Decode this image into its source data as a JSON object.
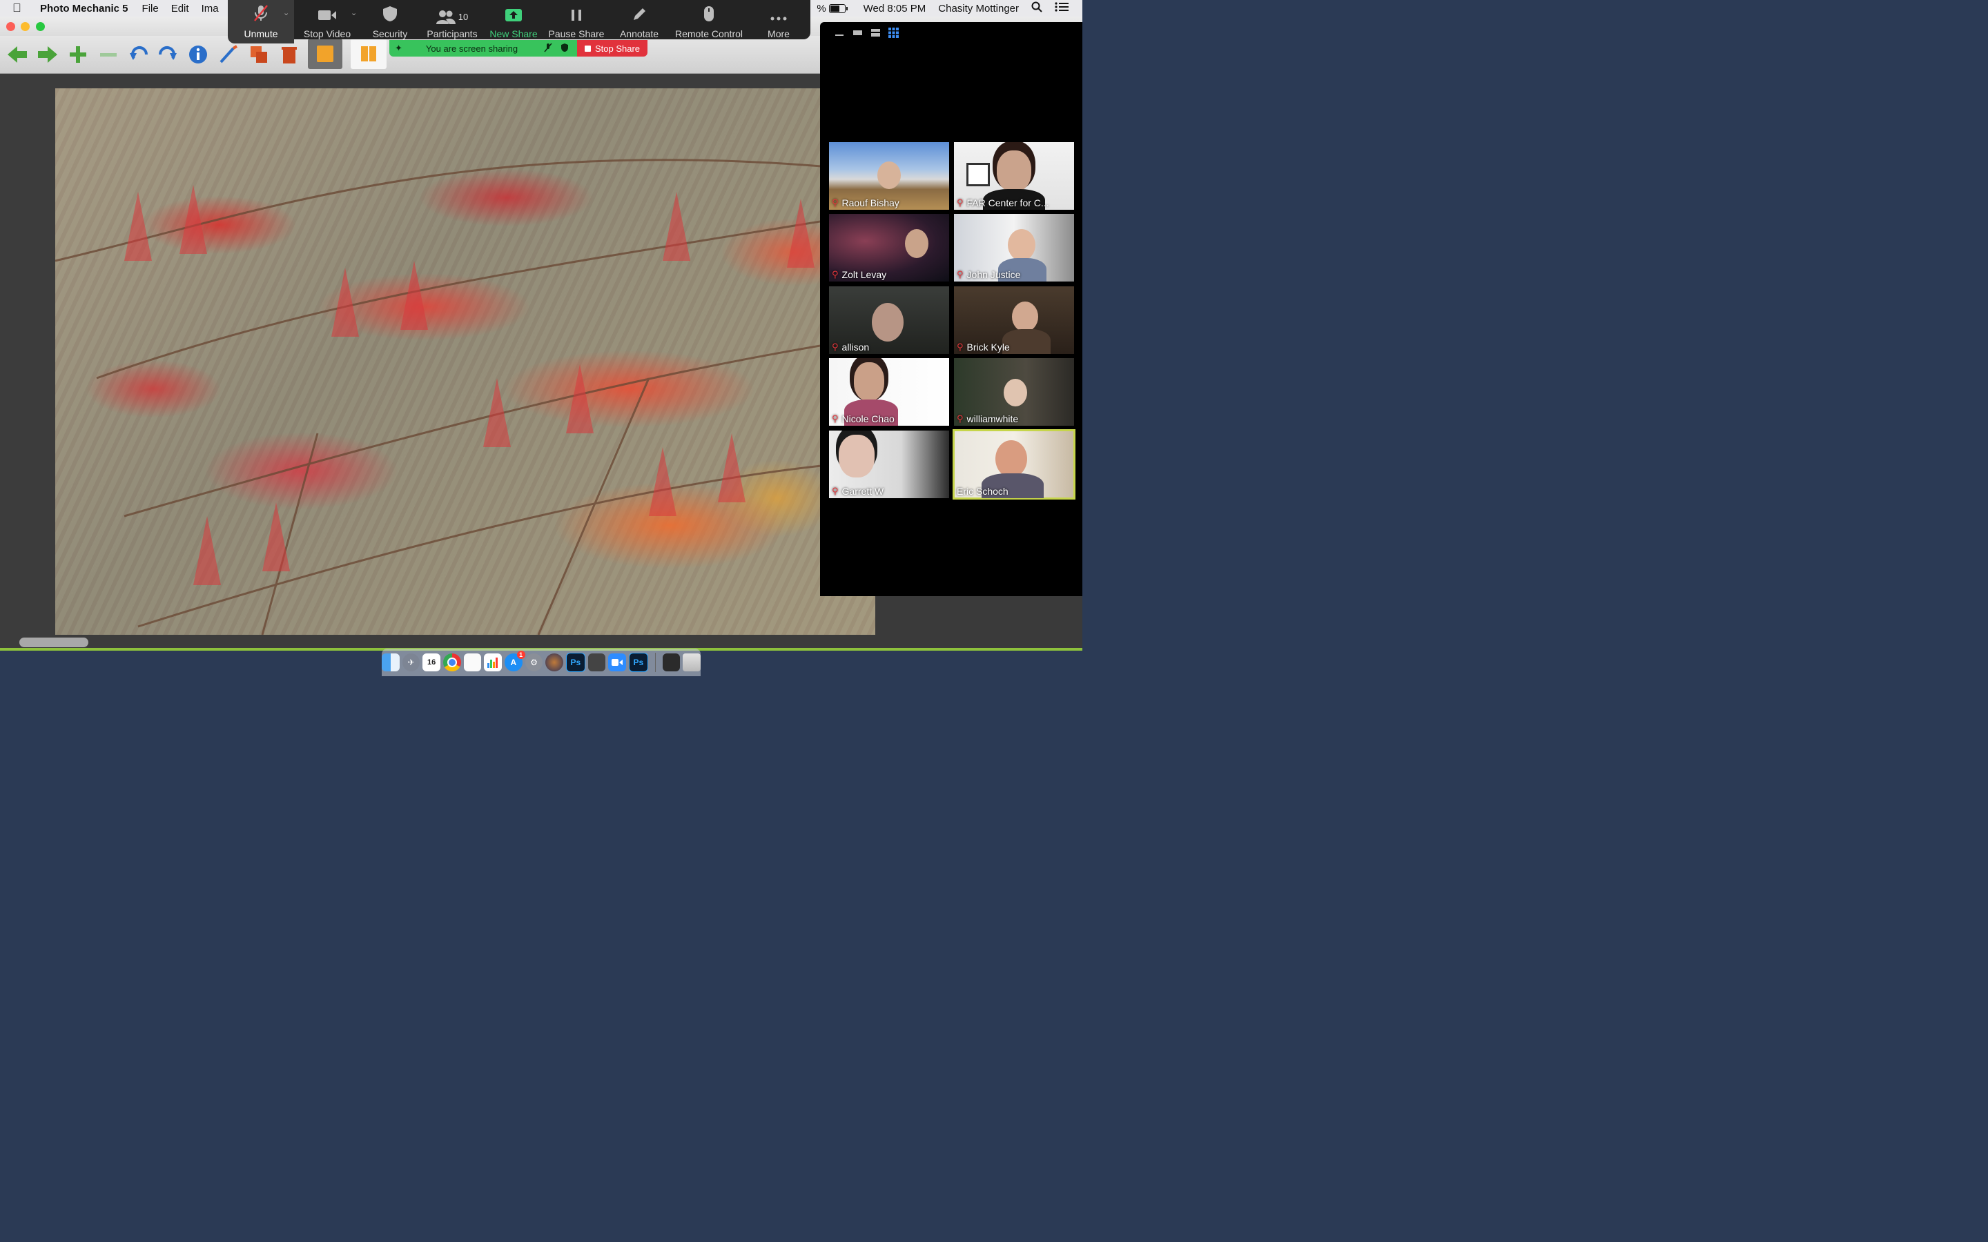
{
  "menubar": {
    "app_name": "Photo Mechanic 5",
    "menus": [
      "File",
      "Edit",
      "Ima"
    ],
    "clock": "Wed 8:05 PM",
    "user": "Chasity Mottinger",
    "battery_prefix": "%"
  },
  "zoom_toolbar": {
    "unmute": "Unmute",
    "stop_video": "Stop Video",
    "security": "Security",
    "participants": "Participants",
    "participant_count": "10",
    "new_share": "New Share",
    "pause_share": "Pause Share",
    "annotate": "Annotate",
    "remote_control": "Remote Control",
    "more": "More"
  },
  "share_banner": {
    "message": "You are screen sharing",
    "stop": "Stop Share"
  },
  "participants": [
    {
      "name": "Raouf Bishay",
      "muted": true
    },
    {
      "name": "FAR Center for C...",
      "muted": true
    },
    {
      "name": "Zolt Levay",
      "muted": true
    },
    {
      "name": "John Justice",
      "muted": true
    },
    {
      "name": "allison",
      "muted": true
    },
    {
      "name": "Brick Kyle",
      "muted": true
    },
    {
      "name": "Nicole Chao",
      "muted": true
    },
    {
      "name": "williamwhite",
      "muted": true
    },
    {
      "name": "Garrett W",
      "muted": true
    },
    {
      "name": "Eric Schoch",
      "muted": false,
      "active_speaker": true
    }
  ],
  "dock": {
    "calendar_day": "16",
    "app_store_badge": "1",
    "ps_label": "Ps"
  },
  "colors": {
    "zoom_green": "#3fd07b",
    "share_green": "#38c35c",
    "stop_red": "#e1323c",
    "speaker_highlight": "#c6d54a",
    "pm_green": "#4aa33a"
  }
}
